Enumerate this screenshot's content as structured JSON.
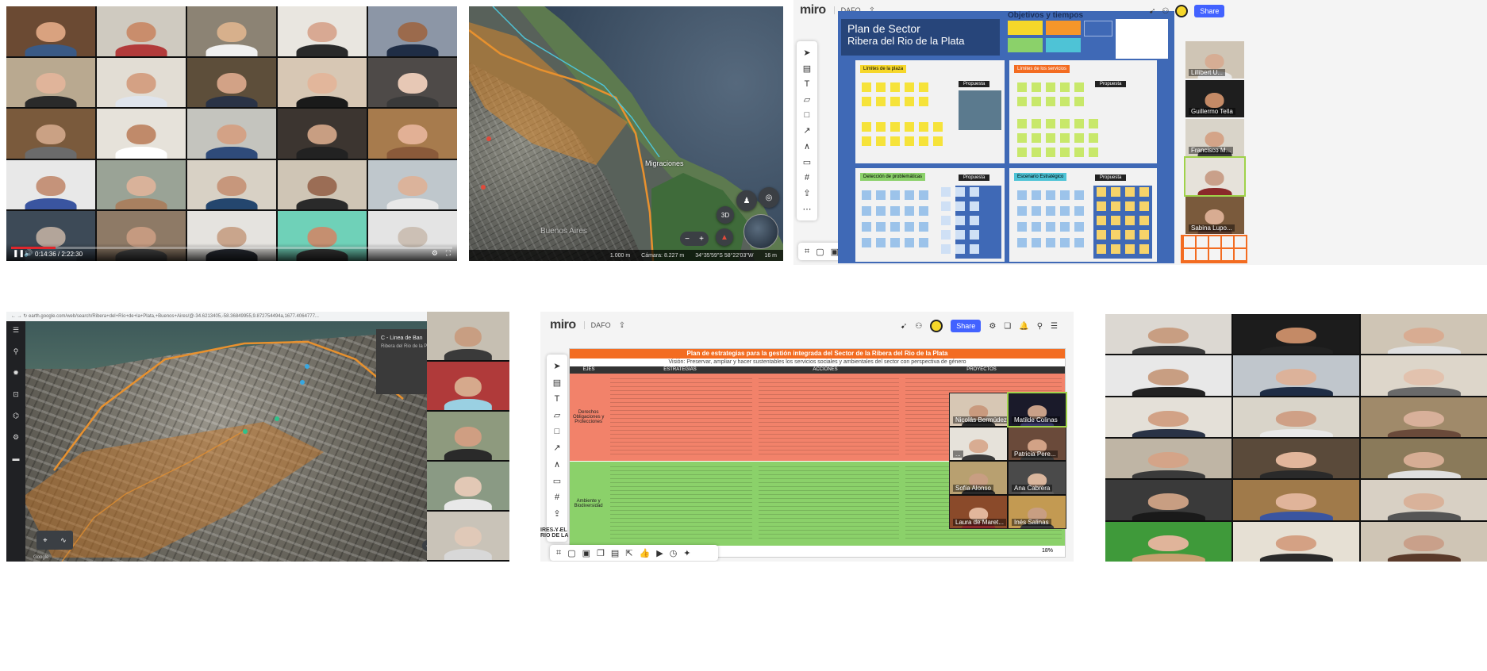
{
  "panel1": {
    "elapsed": "0:14:36 / 2:22:30",
    "progress": 0.1,
    "tiles": [
      {
        "bg": "#6b4a33",
        "skin": "#d9a27f",
        "shirt": "#3a5a86",
        "name": ""
      },
      {
        "bg": "#cfcac0",
        "skin": "#c98d6c",
        "shirt": "#b23b3b",
        "name": ""
      },
      {
        "bg": "#8c8374",
        "skin": "#d7b08c",
        "shirt": "#f0f0f0",
        "name": ""
      },
      {
        "bg": "#e9e6e0",
        "skin": "#d8a993",
        "shirt": "#2a2a2a",
        "name": ""
      },
      {
        "bg": "#8c96a6",
        "skin": "#9b6a4c",
        "shirt": "#1f2d45",
        "name": ""
      },
      {
        "bg": "#b9a990",
        "skin": "#e0b49a",
        "shirt": "#2a2a2a",
        "name": ""
      },
      {
        "bg": "#e2ddd4",
        "skin": "#d4a184",
        "shirt": "#dfe4ec",
        "name": ""
      },
      {
        "bg": "#5d4e3a",
        "skin": "#d2a286",
        "shirt": "#2a3346",
        "name": ""
      },
      {
        "bg": "#d7c7b4",
        "skin": "#e2b69b",
        "shirt": "#1a1a1a",
        "name": ""
      },
      {
        "bg": "#4e4a48",
        "skin": "#e7c8b5",
        "shirt": "#3a3a3a",
        "name": ""
      },
      {
        "bg": "#7a5a3c",
        "skin": "#caa184",
        "shirt": "#6b6b6b",
        "name": ""
      },
      {
        "bg": "#e6e2da",
        "skin": "#c08a6a",
        "shirt": "#ffffff",
        "name": ""
      },
      {
        "bg": "#c4c4be",
        "skin": "#d3a286",
        "shirt": "#2f4b7a",
        "name": ""
      },
      {
        "bg": "#3c3530",
        "skin": "#c89e82",
        "shirt": "#222222",
        "name": ""
      },
      {
        "bg": "#a77b4d",
        "skin": "#e2b095",
        "shirt": "#8a5a3a",
        "name": ""
      },
      {
        "bg": "#e8e8e8",
        "skin": "#c5937a",
        "shirt": "#3a55a0",
        "name": ""
      },
      {
        "bg": "#9aa396",
        "skin": "#d9b29a",
        "shirt": "#a88060",
        "name": ""
      },
      {
        "bg": "#d8d1c5",
        "skin": "#c7977c",
        "shirt": "#24466e",
        "name": ""
      },
      {
        "bg": "#cfc5b5",
        "skin": "#9b6d55",
        "shirt": "#2a2a2a",
        "name": ""
      },
      {
        "bg": "#bfc7cc",
        "skin": "#dbb39b",
        "shirt": "#e8e8e8",
        "name": ""
      },
      {
        "bg": "#3d4a57",
        "skin": "#b3a59a",
        "shirt": "#556677",
        "name": ""
      },
      {
        "bg": "#8e7a66",
        "skin": "#c59a80",
        "shirt": "#4a4a4a",
        "name": ""
      },
      {
        "bg": "#e5e3df",
        "skin": "#c9a58c",
        "shirt": "#2b2f38",
        "name": ""
      },
      {
        "bg": "#6fd1b8",
        "skin": "#c58f70",
        "shirt": "#3a3a3a",
        "name": ""
      },
      {
        "bg": "#e4e4e4",
        "skin": "#ccc0b5",
        "shirt": "#e4e4e4",
        "name": ""
      }
    ]
  },
  "panel2": {
    "label_migraciones": "Migraciones",
    "label_city": "Buenos Aires",
    "btn_3d": "3D",
    "scale": "1.000 m",
    "camera": "Cámara: 8.227 m",
    "coords": "34°35'59\"S 58°22'03\"W",
    "elevation": "16 m"
  },
  "panel3": {
    "logo": "miro",
    "board": "DAFO",
    "title_line1": "Plan de Sector",
    "title_line2": "Ribera del Rio de la Plata",
    "objetivos": "Objetivos y tiempos",
    "frame_labels": [
      "Límites de la plaza",
      "Límites de los servicios",
      "Detección de problemáticas",
      "Escenario Estratégico"
    ],
    "propuesta": "Propuesta",
    "share": "Share",
    "side_names": [
      "Lillibert U...",
      "Guillermo Tella",
      "Francisco M...",
      "",
      "Sabina Lupo..."
    ]
  },
  "panel4": {
    "url": "earth.google.com/web/search/Ribera+del+Río+de+la+Plata,+Buenos+Aires/@-34.6213405,-58.36849955,9.872754494a,1677.4064777...",
    "card_title": "C - Linea de Ban",
    "card_sub": "Ribera del Rio de la P",
    "footer": "Google"
  },
  "panel5": {
    "logo": "miro",
    "board": "DAFO",
    "share": "Share",
    "table_title": "Plan de estrategias para la gestión integrada del Sector de la Ribera del Rio de la Plata",
    "table_sub": "Visión: Preservar, ampliar y hacer sustentables los servicios sociales y ambientales del sector con perspectiva de género",
    "columns": [
      "EJES",
      "ESTRATEGIAS",
      "ACCIONES",
      "PROYECTOS"
    ],
    "rows": [
      {
        "label": "Derechos Obligaciones y Protecciones",
        "color": "#f2826a"
      },
      {
        "label": "Ambiente y Biodiversidad",
        "color": "#8bd16a"
      }
    ],
    "side_text": "IRES Y EL\nRIO DE LA",
    "zoom": "18%",
    "video_names": [
      "Nicolás Bermúdez",
      "Matilde Colinas",
      "...",
      "Patricia Pere...",
      "Sofía Alonso",
      "Ana Cabrera",
      "Laura de Maret...",
      "Inés Salinas"
    ]
  },
  "colors": {
    "miro_blue": "#3f69b6",
    "orange": "#f36c21",
    "map_route": "#e8912e",
    "share": "#4262ff"
  }
}
